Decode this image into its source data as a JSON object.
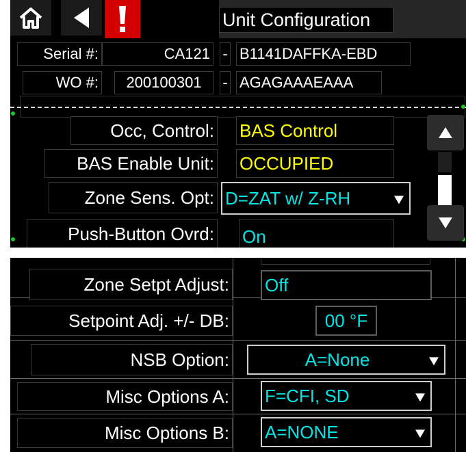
{
  "header": {
    "title": "Unit Configuration",
    "home_icon": "home-icon",
    "back_icon": "back-arrow-icon",
    "alarm_icon": "alarm-exclamation-icon",
    "alarm_color": "#d40000"
  },
  "serial": {
    "label": "Serial #:",
    "prefix": "CA121",
    "sep": "-",
    "suffix": "B1141DAFFKA-EBD"
  },
  "wo": {
    "label": "WO #:",
    "number": "200100301",
    "sep": "-",
    "suffix": "AGAGAAAEAAA"
  },
  "top_rows": [
    {
      "label": "Occ, Control:",
      "value": "BAS Control"
    },
    {
      "label": "BAS Enable Unit:",
      "value": "OCCUPIED"
    },
    {
      "label": "Zone Sens. Opt:",
      "value": "D=ZAT w/ Z-RH"
    },
    {
      "label": "Push-Button Ovrd:",
      "value": "On"
    }
  ],
  "bottom_rows": [
    {
      "label": "Zone Setpt Adjust:",
      "value": "Off"
    },
    {
      "label": "Setpoint Adj. +/- DB:",
      "value": "00 °F"
    },
    {
      "label": "NSB Option:",
      "value": "A=None"
    },
    {
      "label": "Misc Options A:",
      "value": "F=CFI, SD"
    },
    {
      "label": "Misc Options B:",
      "value": "A=NONE"
    }
  ],
  "scroll": {
    "up_icon": "scroll-up-icon",
    "down_icon": "scroll-down-icon"
  },
  "colors": {
    "value_yellow": "#ffff00",
    "value_cyan": "#00e6e6",
    "text_white": "#ffffff",
    "background": "#000000"
  }
}
